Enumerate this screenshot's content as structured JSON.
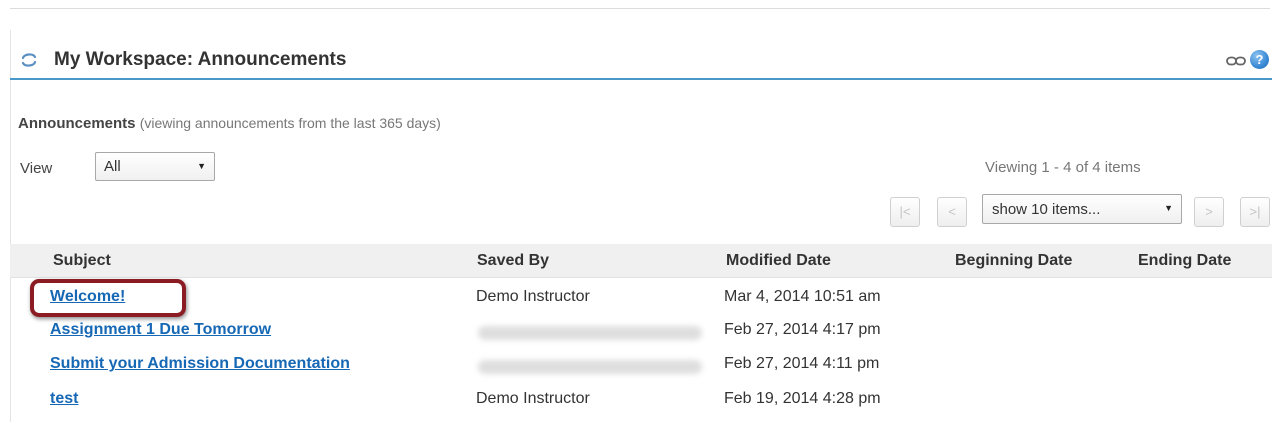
{
  "header": {
    "title": "My Workspace: Announcements",
    "refresh_icon": "refresh-icon",
    "link_icon": "link-icon",
    "help_icon": "help-icon",
    "help_glyph": "?"
  },
  "section": {
    "title": "Announcements",
    "note": "(viewing announcements from the last 365 days)"
  },
  "filter": {
    "view_label": "View",
    "view_value": "All"
  },
  "pager": {
    "viewing_text": "Viewing 1 - 4 of 4 items",
    "first_label": "|<",
    "prev_label": "<",
    "page_size_value": "show 10 items...",
    "next_label": ">",
    "last_label": ">|"
  },
  "table": {
    "columns": [
      "Subject",
      "Saved By",
      "Modified Date",
      "Beginning Date",
      "Ending Date"
    ],
    "rows": [
      {
        "subject": "Welcome!",
        "saved_by": "Demo Instructor",
        "modified": "Mar 4, 2014 10:51 am",
        "beginning": "",
        "ending": ""
      },
      {
        "subject": "Assignment 1 Due Tomorrow",
        "saved_by": "",
        "modified": "Feb 27, 2014 4:17 pm",
        "beginning": "",
        "ending": ""
      },
      {
        "subject": "Submit your Admission Documentation",
        "saved_by": "",
        "modified": "Feb 27, 2014 4:11 pm",
        "beginning": "",
        "ending": ""
      },
      {
        "subject": "test",
        "saved_by": "Demo Instructor",
        "modified": "Feb 19, 2014 4:28 pm",
        "beginning": "",
        "ending": ""
      }
    ]
  },
  "colors": {
    "accent": "#4a97c9",
    "link": "#1668b5",
    "highlight": "#8b1c24"
  }
}
